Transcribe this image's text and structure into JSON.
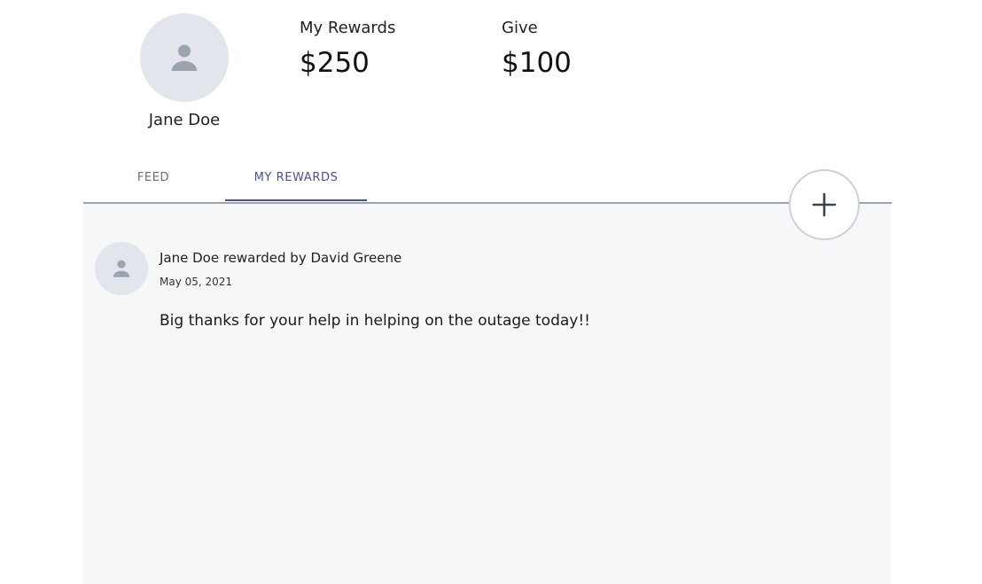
{
  "profile": {
    "name": "Jane Doe",
    "avatar_icon": "person-icon"
  },
  "stats": {
    "rewards_label": "My Rewards",
    "rewards_value": "$250",
    "give_label": "Give",
    "give_value": "$100"
  },
  "tabs": [
    {
      "label": "FEED",
      "active": false
    },
    {
      "label": "MY REWARDS",
      "active": true
    }
  ],
  "add_button": {
    "icon": "plus-icon"
  },
  "feed": [
    {
      "title": "Jane Doe rewarded by David Greene",
      "date": "May 05, 2021",
      "message": "Big thanks for your help in helping on the outage today!!",
      "avatar_icon": "person-icon"
    }
  ],
  "colors": {
    "accent": "#4a4f9a",
    "panel_bg": "#f6f7f9",
    "avatar_bg": "#e2e6ec",
    "avatar_icon": "#9aa3ae"
  }
}
